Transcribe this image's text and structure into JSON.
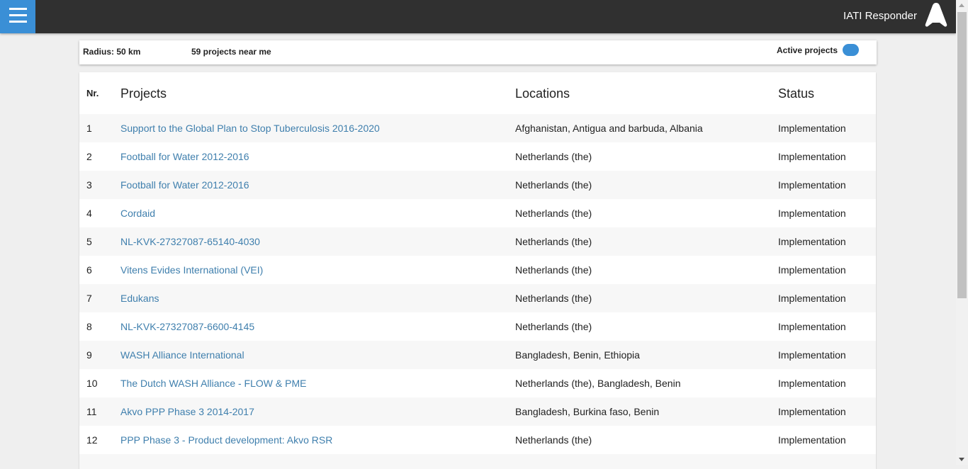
{
  "header": {
    "app_title": "IATI Responder",
    "menu_icon": "hamburger-menu-icon",
    "logo_icon": "a-logo-icon",
    "accent": "#3a8fd6",
    "bar_color": "#303030"
  },
  "filter": {
    "radius": "Radius: 50 km",
    "count": "59 projects near me",
    "active_label": "Active projects",
    "active_on": true
  },
  "table": {
    "headers": {
      "nr": "Nr.",
      "projects": "Projects",
      "locations": "Locations",
      "status": "Status"
    },
    "rows": [
      {
        "nr": "1",
        "project": "Support to the Global Plan to Stop Tuberculosis 2016-2020",
        "locations": "Afghanistan,  Antigua and barbuda,  Albania",
        "status": "Implementation"
      },
      {
        "nr": "2",
        "project": "Football for Water 2012-2016",
        "locations": "Netherlands (the)",
        "status": "Implementation"
      },
      {
        "nr": "3",
        "project": "Football for Water 2012-2016",
        "locations": "Netherlands (the)",
        "status": "Implementation"
      },
      {
        "nr": "4",
        "project": "Cordaid",
        "locations": "Netherlands (the)",
        "status": "Implementation"
      },
      {
        "nr": "5",
        "project": "NL-KVK-27327087-65140-4030",
        "locations": "Netherlands (the)",
        "status": "Implementation"
      },
      {
        "nr": "6",
        "project": "Vitens Evides International (VEI)",
        "locations": "Netherlands (the)",
        "status": "Implementation"
      },
      {
        "nr": "7",
        "project": "Edukans",
        "locations": "Netherlands (the)",
        "status": "Implementation"
      },
      {
        "nr": "8",
        "project": "NL-KVK-27327087-6600-4145",
        "locations": "Netherlands (the)",
        "status": "Implementation"
      },
      {
        "nr": "9",
        "project": "WASH Alliance International",
        "locations": "Bangladesh,  Benin,  Ethiopia",
        "status": "Implementation"
      },
      {
        "nr": "10",
        "project": "The Dutch WASH Alliance - FLOW & PME",
        "locations": "Netherlands (the),  Bangladesh,  Benin",
        "status": "Implementation"
      },
      {
        "nr": "11",
        "project": "Akvo PPP Phase 3 2014-2017",
        "locations": "Bangladesh,  Burkina faso,  Benin",
        "status": "Implementation"
      },
      {
        "nr": "12",
        "project": "PPP Phase 3 - Product development: Akvo RSR",
        "locations": "Netherlands (the)",
        "status": "Implementation"
      }
    ]
  }
}
